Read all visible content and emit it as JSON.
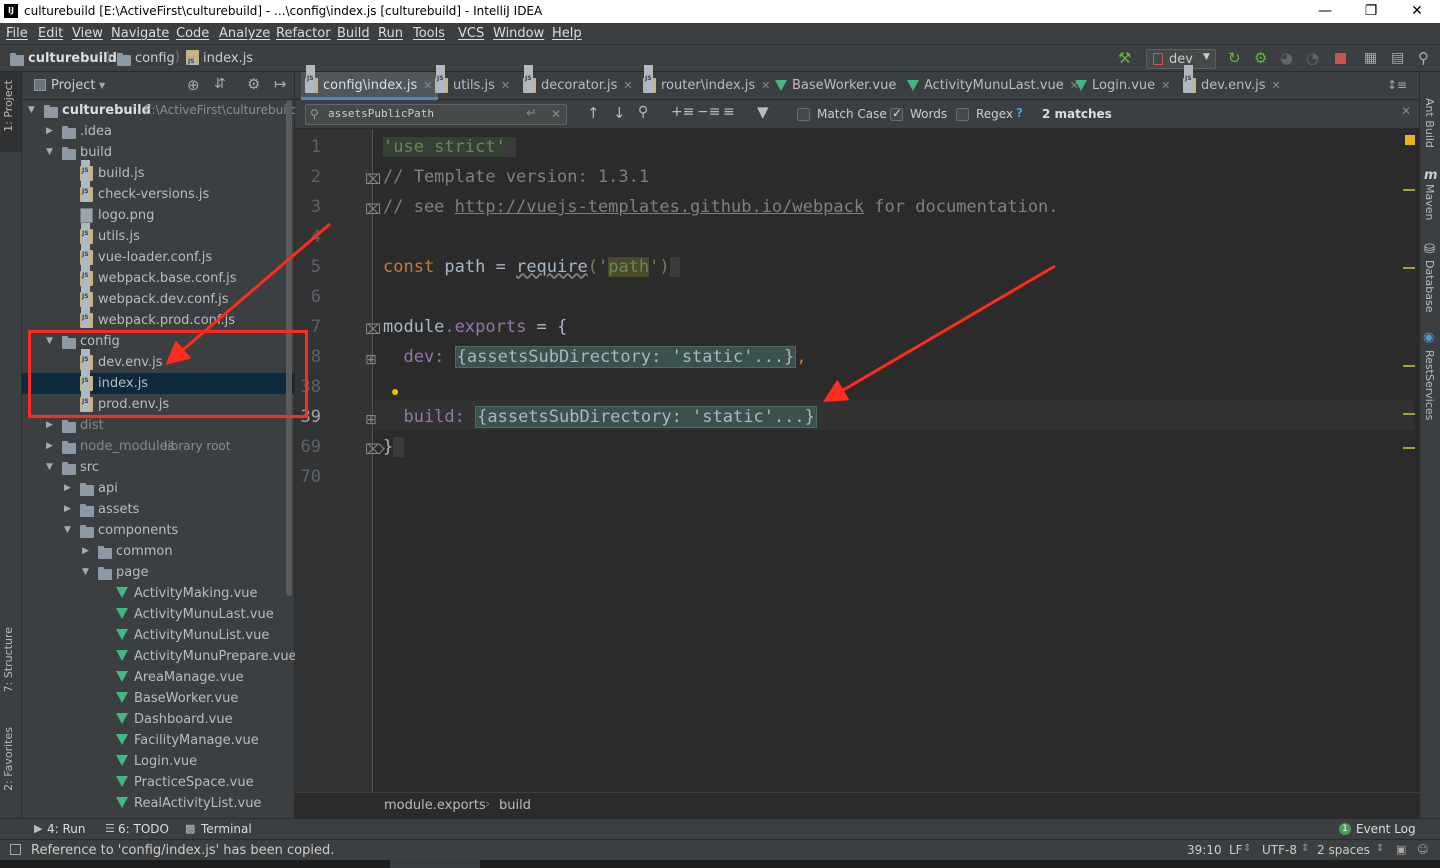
{
  "window": {
    "title": "culturebuild [E:\\ActiveFirst\\culturebuild] - ...\\config\\index.js [culturebuild] - IntelliJ IDEA",
    "app_icon": "IJ"
  },
  "menu": [
    "File",
    "Edit",
    "View",
    "Navigate",
    "Code",
    "Analyze",
    "Refactor",
    "Build",
    "Run",
    "Tools",
    "VCS",
    "Window",
    "Help"
  ],
  "nav": {
    "project": "culturebuild",
    "folder": "config",
    "file": "index.js",
    "run_config": "dev"
  },
  "left_tabs": {
    "project": "1: Project",
    "structure": "7: Structure",
    "favorites": "2: Favorites"
  },
  "right_tabs": {
    "ant": "Ant Build",
    "maven": "Maven",
    "database": "Database",
    "rest": "RestServices"
  },
  "project_panel": {
    "title": "Project",
    "tree": [
      {
        "label": "culturebuild",
        "suffix": "E:\\ActiveFirst\\culturebuild",
        "type": "folder",
        "level": 0,
        "arrow": "down",
        "bold": true
      },
      {
        "label": ".idea",
        "type": "folder",
        "level": 1,
        "arrow": "right"
      },
      {
        "label": "build",
        "type": "folder",
        "level": 1,
        "arrow": "down"
      },
      {
        "label": "build.js",
        "type": "js",
        "level": 2
      },
      {
        "label": "check-versions.js",
        "type": "js",
        "level": 2
      },
      {
        "label": "logo.png",
        "type": "img",
        "level": 2
      },
      {
        "label": "utils.js",
        "type": "js",
        "level": 2
      },
      {
        "label": "vue-loader.conf.js",
        "type": "js",
        "level": 2
      },
      {
        "label": "webpack.base.conf.js",
        "type": "js",
        "level": 2
      },
      {
        "label": "webpack.dev.conf.js",
        "type": "js",
        "level": 2
      },
      {
        "label": "webpack.prod.conf.js",
        "type": "js",
        "level": 2
      },
      {
        "label": "config",
        "type": "folder",
        "level": 1,
        "arrow": "down"
      },
      {
        "label": "dev.env.js",
        "type": "js",
        "level": 2
      },
      {
        "label": "index.js",
        "type": "js",
        "level": 2,
        "selected": true
      },
      {
        "label": "prod.env.js",
        "type": "js",
        "level": 2
      },
      {
        "label": "dist",
        "type": "folder",
        "level": 1,
        "arrow": "right",
        "dim": true
      },
      {
        "label": "node_modules",
        "suffix": "library root",
        "type": "folder",
        "level": 1,
        "arrow": "right",
        "dim": true
      },
      {
        "label": "src",
        "type": "folder",
        "level": 1,
        "arrow": "down"
      },
      {
        "label": "api",
        "type": "folder",
        "level": 2,
        "arrow": "right"
      },
      {
        "label": "assets",
        "type": "folder",
        "level": 2,
        "arrow": "right"
      },
      {
        "label": "components",
        "type": "folder",
        "level": 2,
        "arrow": "down"
      },
      {
        "label": "common",
        "type": "folder",
        "level": 3,
        "arrow": "right"
      },
      {
        "label": "page",
        "type": "folder",
        "level": 3,
        "arrow": "down"
      },
      {
        "label": "ActivityMaking.vue",
        "type": "vue",
        "level": 4
      },
      {
        "label": "ActivityMunuLast.vue",
        "type": "vue",
        "level": 4
      },
      {
        "label": "ActivityMunuList.vue",
        "type": "vue",
        "level": 4
      },
      {
        "label": "ActivityMunuPrepare.vue",
        "type": "vue",
        "level": 4
      },
      {
        "label": "AreaManage.vue",
        "type": "vue",
        "level": 4
      },
      {
        "label": "BaseWorker.vue",
        "type": "vue",
        "level": 4
      },
      {
        "label": "Dashboard.vue",
        "type": "vue",
        "level": 4
      },
      {
        "label": "FacilityManage.vue",
        "type": "vue",
        "level": 4
      },
      {
        "label": "Login.vue",
        "type": "vue",
        "level": 4
      },
      {
        "label": "PracticeSpace.vue",
        "type": "vue",
        "level": 4
      },
      {
        "label": "RealActivityList.vue",
        "type": "vue",
        "level": 4
      }
    ]
  },
  "tabs": [
    {
      "label": "config\\index.js",
      "type": "js",
      "active": true
    },
    {
      "label": "utils.js",
      "type": "js"
    },
    {
      "label": "decorator.js",
      "type": "js"
    },
    {
      "label": "router\\index.js",
      "type": "js"
    },
    {
      "label": "BaseWorker.vue",
      "type": "vue",
      "no_close": true
    },
    {
      "label": "ActivityMunuLast.vue",
      "type": "vue"
    },
    {
      "label": "Login.vue",
      "type": "vue"
    },
    {
      "label": "dev.env.js",
      "type": "js"
    }
  ],
  "search": {
    "query": "assetsPublicPath",
    "match_case": "Match Case",
    "words": "Words",
    "regex": "Regex",
    "help": "?",
    "result": "2 matches"
  },
  "editor": {
    "line_numbers": [
      "1",
      "2",
      "3",
      "4",
      "5",
      "6",
      "7",
      "8",
      "38",
      "39",
      "69",
      "70"
    ],
    "lines": {
      "l1": "'use strict'",
      "l2": "// Template version: 1.3.1",
      "l3_pre": "// see ",
      "l3_link": "http://vuejs-templates.github.io/webpack",
      "l3_post": " for documentation.",
      "l5_kw": "const",
      "l5_mid": " path = ",
      "l5_fn": "require",
      "l5_open": "('",
      "l5_str": "path",
      "l5_close": "')",
      "l7_a": "module",
      "l7_b": ".exports",
      "l7_c": " = {",
      "l8_key": "  dev: ",
      "l8_fold": "{assetsSubDirectory: 'static'...}",
      "l8_end": ",",
      "l39_key": "  build: ",
      "l39_fold": "{assetsSubDirectory: 'static'...}",
      "l69": "}"
    }
  },
  "breadcrumb": {
    "a": "module.exports",
    "b": "build"
  },
  "bottom_tools": {
    "run": "4: Run",
    "todo": "6: TODO",
    "terminal": "Terminal",
    "event_log": "Event Log",
    "event_count": "1"
  },
  "status": {
    "message": "Reference to 'config/index.js' has been copied.",
    "position": "39:10",
    "line_sep": "LF",
    "encoding": "UTF-8",
    "indent": "2 spaces"
  },
  "colors": {
    "accent": "#4a88c7",
    "annotation": "#ff2b1c",
    "vue": "#41b883"
  }
}
